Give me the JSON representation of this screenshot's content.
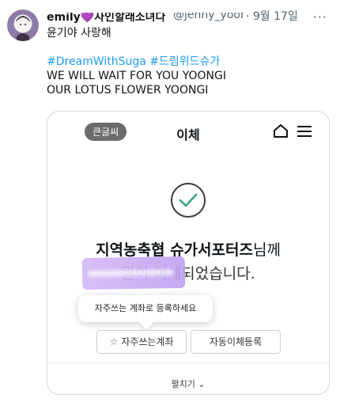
{
  "tweet": {
    "display_name": "emily💜사인할래소녀다",
    "handle": "@jenny_yoongi",
    "date": "· 9월 17일",
    "more": "···",
    "text_line1": "윤기야 사랑해",
    "hashtags": [
      "#DreamWithSuga",
      "#드림위드슈가"
    ],
    "text_line3": "WE WILL WAIT FOR YOU YOONGI",
    "text_line4": "OUR LOTUS FLOWER YOONGI"
  },
  "card": {
    "pill_label": "큰글씨",
    "title": "이체",
    "message_bold": "지역농축협 슈가서포터즈",
    "message_suffix": "님께",
    "message_line2": "원이 이체되었습니다.",
    "tooltip": "자주쓰는 계좌로 등록하세요",
    "fav_button": "자주쓰는계좌",
    "auto_button": "자동이체등록",
    "expand_label": "펼치기 ⌄"
  },
  "colors": {
    "hashtag": "#1d9bf0",
    "check": "#3a3a3a",
    "highlight": "#c9b0f2"
  },
  "icons": [
    "more-icon",
    "home-icon",
    "menu-icon",
    "check-circle-icon",
    "star-icon"
  ]
}
